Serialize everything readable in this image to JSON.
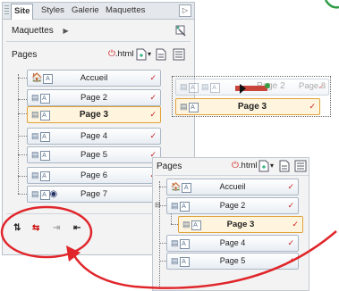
{
  "tabs": [
    "Site",
    "Styles",
    "Galerie",
    "Maquettes"
  ],
  "collapse_glyph": "▷",
  "maquettes": {
    "label": "Maquettes",
    "arrow": "▶"
  },
  "pages_header": {
    "label": "Pages",
    "html_label": ".html",
    "dropdown": "▾"
  },
  "pages": [
    {
      "label": "Accueil",
      "home": true
    },
    {
      "label": "Page 2"
    },
    {
      "label": "Page 3",
      "selected": true
    },
    {
      "label": "Page 4"
    },
    {
      "label": "Page 5"
    },
    {
      "label": "Page 6"
    },
    {
      "label": "Page 7"
    }
  ],
  "drag": {
    "ghost_label": "Page 2",
    "ghost_page3": "Page 3",
    "target_label": "Page 3"
  },
  "panel2": {
    "header": "Pages",
    "html_label": ".html",
    "pages": [
      {
        "label": "Accueil"
      },
      {
        "label": "Page 2"
      },
      {
        "label": "Page 3",
        "selected": true
      },
      {
        "label": "Page 4"
      },
      {
        "label": "Page 5"
      }
    ]
  },
  "check": "✓",
  "colors": {
    "highlight_circle": "#e0262b",
    "arrow": "#e0262b",
    "selected_border": "#e0a23a"
  }
}
